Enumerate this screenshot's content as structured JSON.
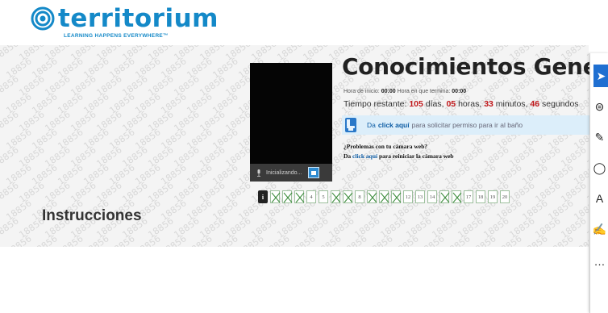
{
  "logo": {
    "name": "territorium",
    "tagline": "LEARNING HAPPENS EVERYWHERE™"
  },
  "watermark_text": "18856",
  "exam": {
    "title": "Conocimientos General",
    "start_label": "Hora de inicio:",
    "start_value": "00:00",
    "end_label": "Hora en que termina:",
    "end_value": "00:00",
    "remaining_label": "Tiempo restante:",
    "days": "105",
    "days_label": "días,",
    "hours": "05",
    "hours_label": "horas,",
    "minutes": "33",
    "minutes_label": "minutos,",
    "seconds": "46",
    "seconds_label": "segundos"
  },
  "bathroom": {
    "prefix": "Da",
    "link": "click aquí",
    "suffix": "para solicitar permiso para ir al baño"
  },
  "camera": {
    "status": "Inicializando...",
    "problems_title": "¿Problemas con tu cámara web?",
    "prefix": "Da",
    "link": "click aquí",
    "suffix": "para reiniciar la cámara web"
  },
  "pager": {
    "info_symbol": "i",
    "pages": [
      {
        "n": "1",
        "answered": true
      },
      {
        "n": "2",
        "answered": true
      },
      {
        "n": "3",
        "answered": true
      },
      {
        "n": "4",
        "answered": false
      },
      {
        "n": "5",
        "answered": false
      },
      {
        "n": "6",
        "answered": true
      },
      {
        "n": "7",
        "answered": true
      },
      {
        "n": "8",
        "answered": false
      },
      {
        "n": "9",
        "answered": true
      },
      {
        "n": "10",
        "answered": true
      },
      {
        "n": "11",
        "answered": true
      },
      {
        "n": "12",
        "answered": false
      },
      {
        "n": "13",
        "answered": false
      },
      {
        "n": "14",
        "answered": false
      },
      {
        "n": "15",
        "answered": true
      },
      {
        "n": "16",
        "answered": true
      },
      {
        "n": "17",
        "answered": false
      },
      {
        "n": "18",
        "answered": false
      },
      {
        "n": "19",
        "answered": false
      },
      {
        "n": "20",
        "answered": false
      }
    ]
  },
  "instructions_heading": "Instrucciones",
  "toolbar": {
    "tools": [
      {
        "name": "select-cursor-icon",
        "glyph": "➤",
        "selected": true
      },
      {
        "name": "text-lines-icon",
        "glyph": "⊜",
        "selected": false
      },
      {
        "name": "pen-icon",
        "glyph": "✎",
        "selected": false
      },
      {
        "name": "lasso-icon",
        "glyph": "◯",
        "selected": false
      },
      {
        "name": "text-select-icon",
        "glyph": "A",
        "selected": false
      },
      {
        "name": "ink-icon",
        "glyph": "✍",
        "selected": false
      },
      {
        "name": "more-icon",
        "glyph": "…",
        "selected": false
      }
    ]
  },
  "colors": {
    "brand": "#1489c8",
    "accent_red": "#c0181b",
    "link": "#0d5ca4",
    "selected_tool": "#1f6fd1"
  }
}
